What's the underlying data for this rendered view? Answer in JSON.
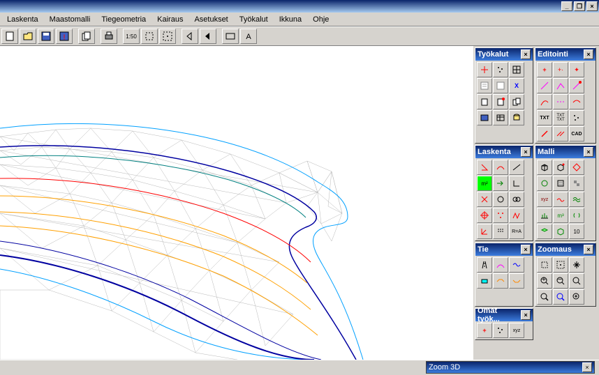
{
  "window_controls": {
    "min": "_",
    "max": "❐",
    "close": "×"
  },
  "menu": [
    "Laskenta",
    "Maastomalli",
    "Tiegeometria",
    "Kairaus",
    "Asetukset",
    "Työkalut",
    "Ikkuna",
    "Ohje"
  ],
  "toolbar_icons": [
    "file-new",
    "file-open",
    "file-save",
    "save-warn",
    "multi-doc",
    "print",
    "scale-150",
    "zoom-extents",
    "zoom-fit",
    "arrow-left",
    "arrow-left-2",
    "rectangle",
    "text-a"
  ],
  "panels": {
    "tyokalut": {
      "title": "Työkalut",
      "rows": 5,
      "cols": 3
    },
    "editointi": {
      "title": "Editointi",
      "rows": 5,
      "cols": 3
    },
    "laskenta": {
      "title": "Laskenta",
      "rows": 5,
      "cols": 3
    },
    "malli": {
      "title": "Malli",
      "rows": 5,
      "cols": 3
    },
    "tie": {
      "title": "Tie",
      "rows": 2,
      "cols": 3
    },
    "zoomaus": {
      "title": "Zoomaus",
      "rows": 3,
      "cols": 3
    },
    "omat": {
      "title": "Omat työk...",
      "rows": 1,
      "cols": 3
    }
  },
  "status": {
    "label": "Zoom 3D"
  },
  "icon_glyphs": {
    "plus-red": "+",
    "x-blue": "X",
    "txt": "TXT",
    "cad": "CAD",
    "xyz": "xyz",
    "m2": "m²",
    "m3": "m³",
    "ra": "R=A",
    "ten": "10"
  },
  "chart_data": {
    "type": "other",
    "description": "3D terrain wireframe mesh (TIN triangulation) of a road cross-section, rendered in plan view",
    "layers": [
      {
        "name": "triangulation-mesh",
        "color": "#b0b0b0",
        "style": "thin-wireframe"
      },
      {
        "name": "outer-boundary",
        "color": "#00a0ff",
        "style": "polyline"
      },
      {
        "name": "road-edge-dark-blue",
        "color": "#0000a0",
        "style": "polyline-thick"
      },
      {
        "name": "road-centerline",
        "color": "#ff0000",
        "style": "polyline"
      },
      {
        "name": "lane-lines",
        "color": "#ffa000",
        "style": "polyline"
      },
      {
        "name": "inner-contour",
        "color": "#008080",
        "style": "polyline"
      }
    ],
    "view": "plan/3D isometric, road curving from upper-left toward lower-right with a bulge/intersection on the right side"
  }
}
